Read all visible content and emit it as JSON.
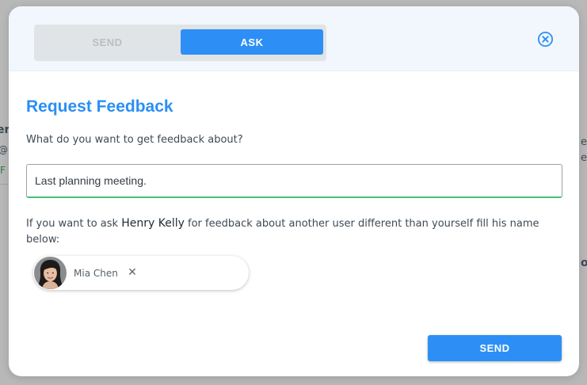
{
  "background": {
    "left_fragments": [
      "er",
      "@",
      "F"
    ],
    "right_fragments": [
      "ea",
      "ee",
      "ov"
    ]
  },
  "tabs": {
    "send_label": "SEND",
    "ask_label": "ASK",
    "active": "ASK"
  },
  "close_icon": "close-circle-icon",
  "form": {
    "title": "Request Feedback",
    "question_label": "What do you want to get feedback about?",
    "topic_value": "Last planning meeting.",
    "helper_prefix": "If you want to ask ",
    "helper_name": "Henry Kelly",
    "helper_suffix": " for feedback about another user different than yourself fill his name below:",
    "selected_user": {
      "name": "Mia Chen",
      "remove_symbol": "✕"
    },
    "submit_label": "SEND"
  },
  "colors": {
    "accent": "#2d8ff5",
    "title": "#2b8ff3",
    "input_focus": "#45c079",
    "header_bg": "#f1f7fc"
  }
}
